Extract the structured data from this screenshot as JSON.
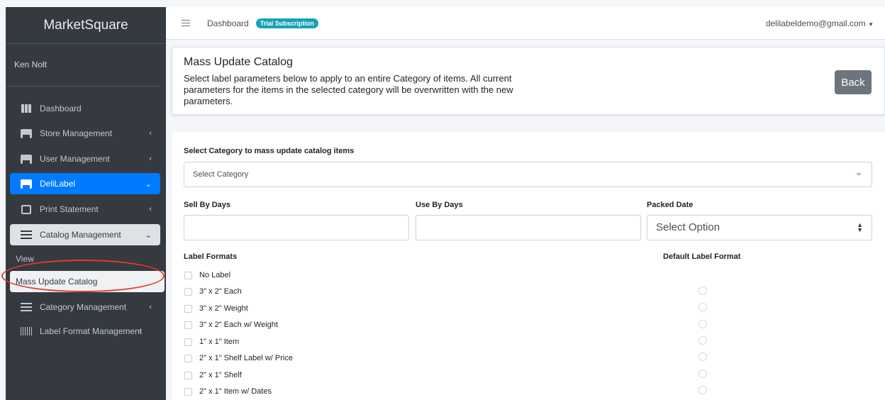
{
  "sidebar": {
    "brand": "MarketSquare",
    "user": "Ken Nolt",
    "items": [
      {
        "label": "Dashboard"
      },
      {
        "label": "Store Management"
      },
      {
        "label": "User Management"
      },
      {
        "label": "DeliLabel"
      },
      {
        "label": "Print Statement"
      },
      {
        "label": "Catalog Management"
      },
      {
        "label": "View"
      },
      {
        "label": "Mass Update Catalog"
      },
      {
        "label": "Category Management"
      },
      {
        "label": "Label Format Management"
      }
    ]
  },
  "topbar": {
    "breadcrumb": "Dashboard",
    "badge": "Trial Subscription",
    "account": "delilabeldemo@gmail.com"
  },
  "header": {
    "title": "Mass Update Catalog",
    "description": "Select label parameters below to apply to an entire Category of items. All current parameters for the items in the selected category will be overwritten with the new parameters.",
    "back_label": "Back"
  },
  "form": {
    "category_label": "Select Category to mass update catalog items",
    "category_placeholder": "Select Category",
    "sell_by_label": "Sell By Days",
    "sell_by_value": "",
    "use_by_label": "Use By Days",
    "use_by_value": "",
    "packed_date_label": "Packed Date",
    "packed_date_value": "Select Option",
    "label_formats_label": "Label Formats",
    "default_format_label": "Default Label Format",
    "formats": [
      {
        "label": "No Label"
      },
      {
        "label": "3\" x 2\" Each"
      },
      {
        "label": "3\" x 2\" Weight"
      },
      {
        "label": "3\" x 2\" Each w/ Weight"
      },
      {
        "label": "1\" x 1\" Item"
      },
      {
        "label": "2\" x 1\" Shelf Label w/ Price"
      },
      {
        "label": "2\" x 1\" Shelf"
      },
      {
        "label": "2\" x 1\" Item w/ Dates"
      }
    ]
  },
  "colors": {
    "sidebar_bg": "#343a40",
    "active": "#007bff",
    "badge": "#17a2b8",
    "highlight": "#e23b2e"
  }
}
